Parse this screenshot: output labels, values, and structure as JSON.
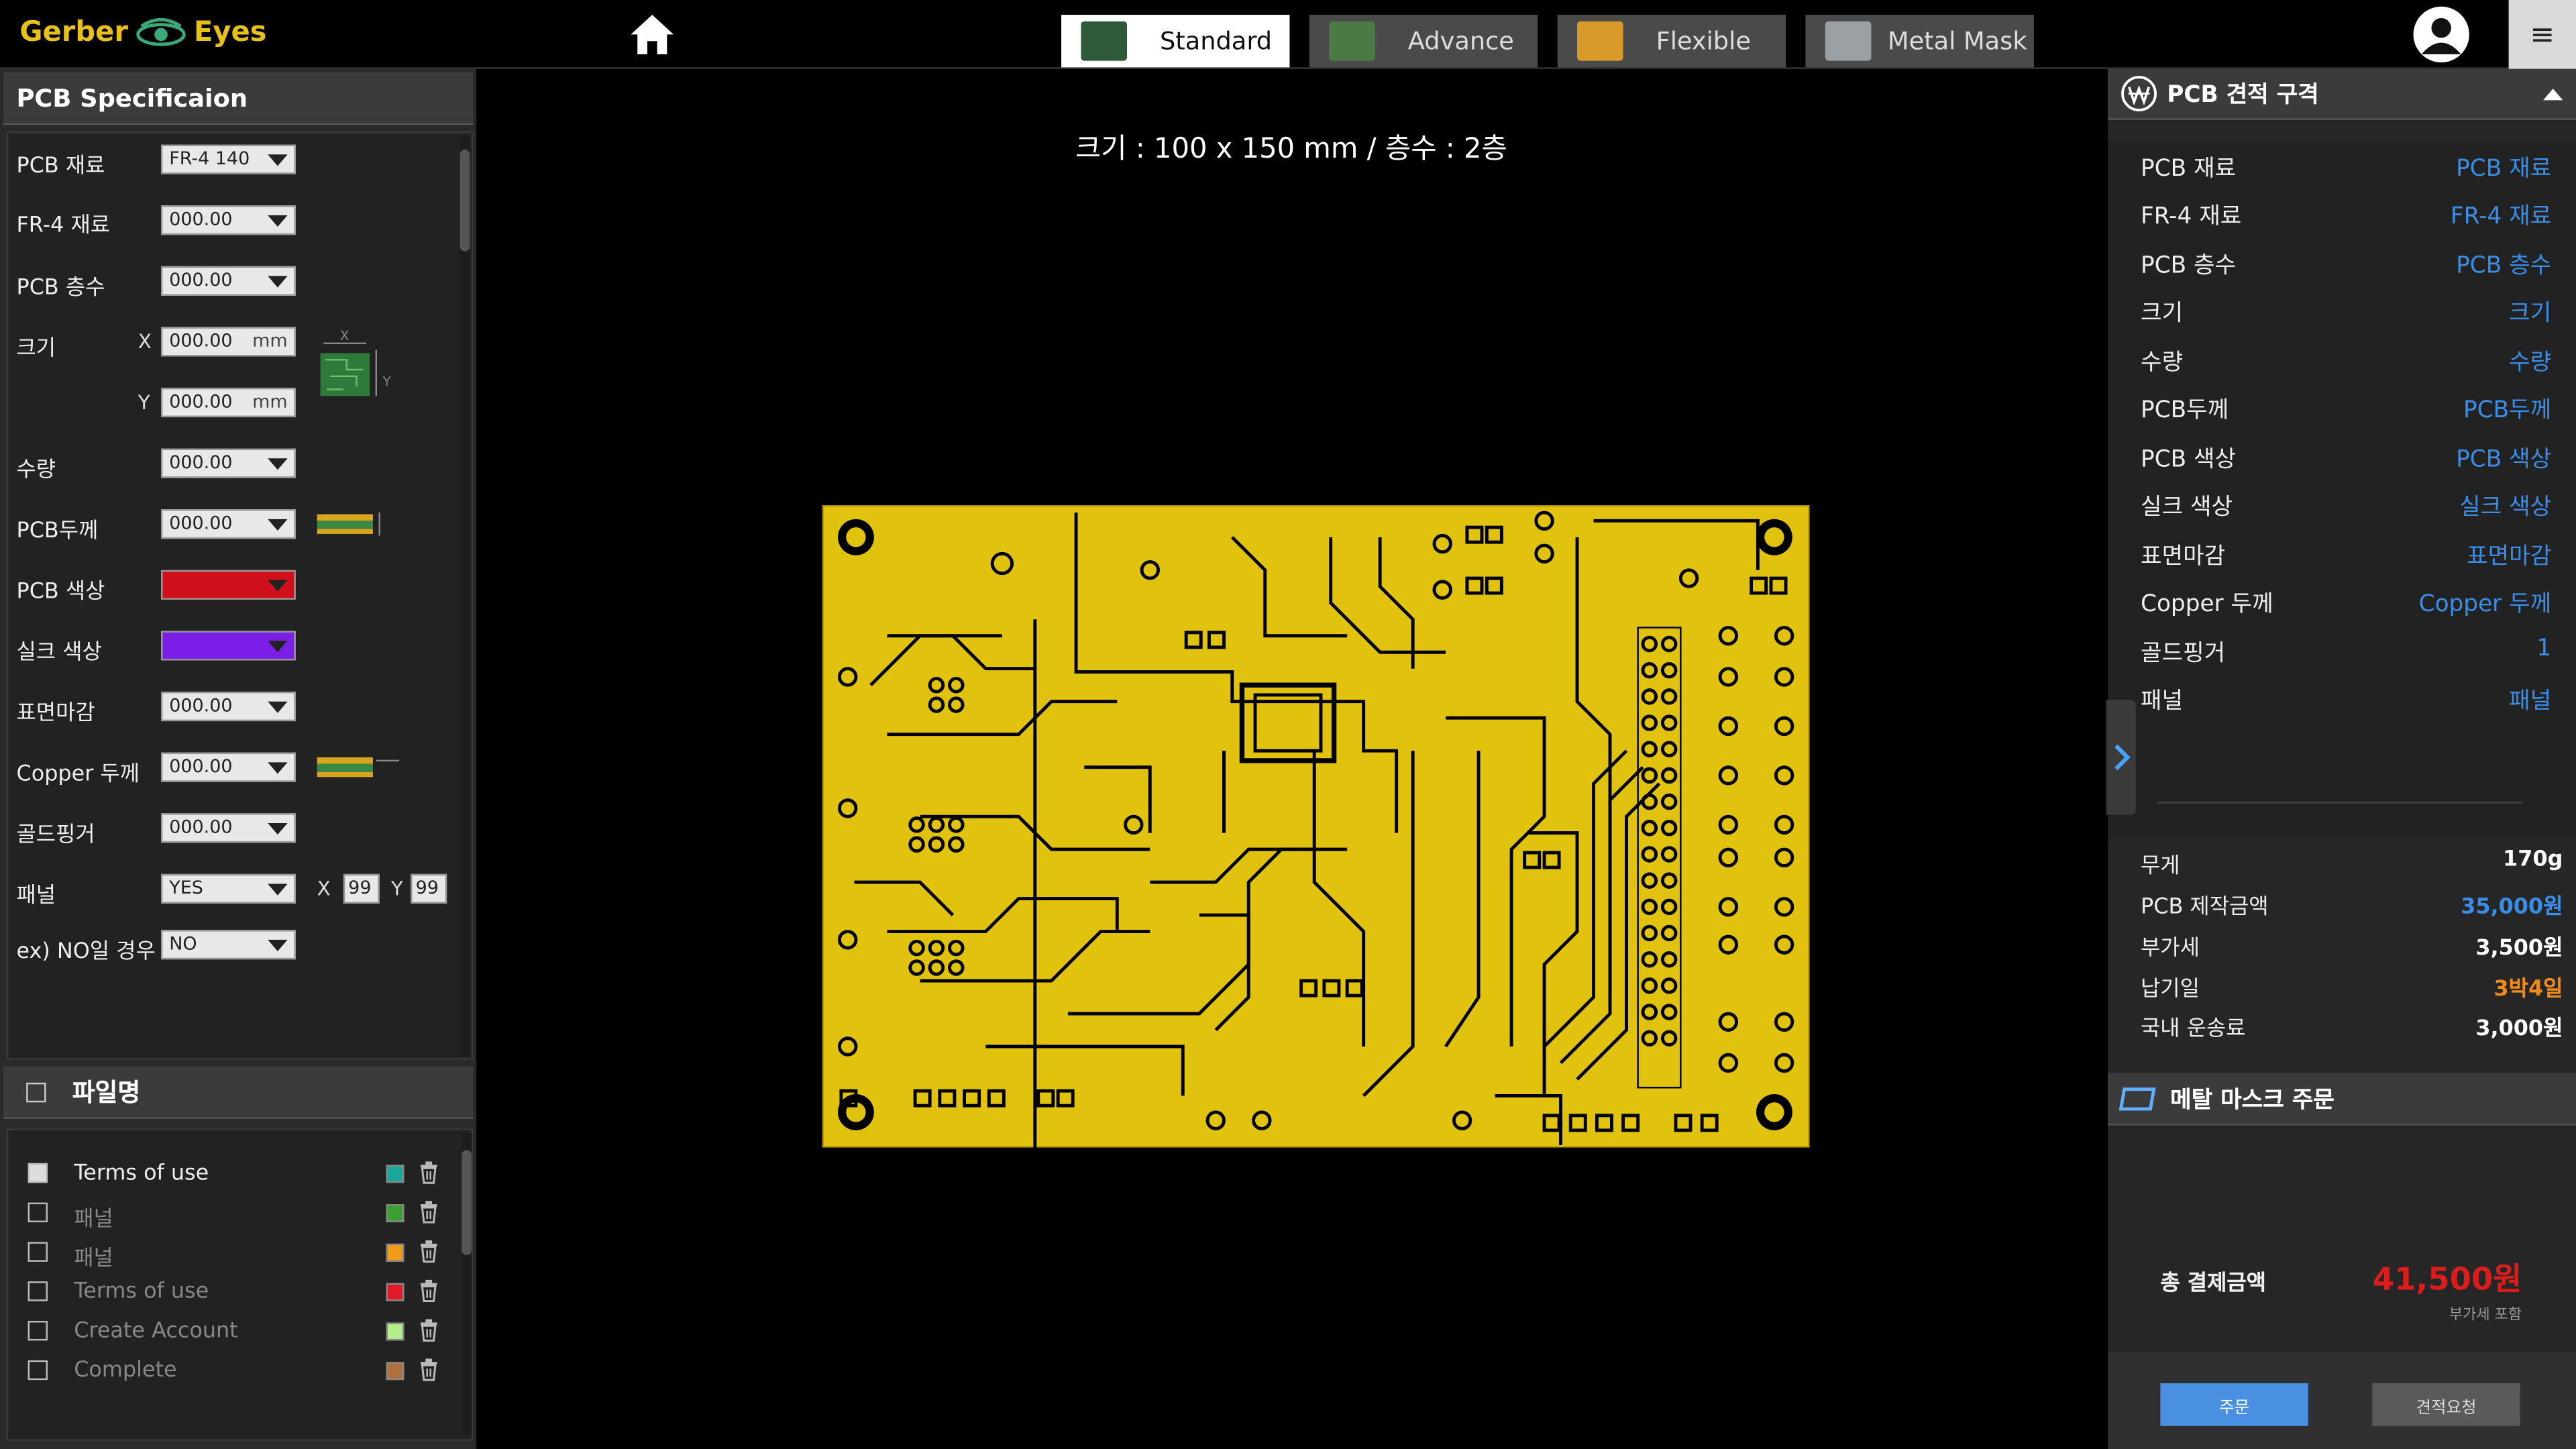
{
  "app": {
    "logo_left": "Gerber",
    "logo_right": "Eyes",
    "mode_tabs": [
      {
        "label": "Standard",
        "active": true
      },
      {
        "label": "Advance",
        "active": false
      },
      {
        "label": "Flexible",
        "active": false
      },
      {
        "label": "Metal Mask",
        "active": false
      }
    ],
    "menu_icon": "≡"
  },
  "left": {
    "spec_title": "PCB Specificaion",
    "fields": [
      {
        "label": "PCB  재료",
        "value": "FR-4 140"
      },
      {
        "label": "FR-4 재료",
        "value": "000.00"
      },
      {
        "label": "PCB 층수",
        "value": "000.00"
      },
      {
        "label": "크기",
        "x_label": "X",
        "x_value": "000.00",
        "y_label": "Y",
        "y_value": "000.00",
        "unit": "mm"
      },
      {
        "label": "수량",
        "value": "000.00"
      },
      {
        "label": "PCB두께",
        "value": "000.00"
      },
      {
        "label": "PCB 색상",
        "color": "#d0101a"
      },
      {
        "label": "실크 색상",
        "color": "#7b1fe8"
      },
      {
        "label": "표면마감",
        "value": "000.00"
      },
      {
        "label": "Copper 두께",
        "value": "000.00"
      },
      {
        "label": "골드핑거",
        "value": "000.00"
      },
      {
        "label": "패널",
        "value": "YES",
        "x_label": "X",
        "x_value": "99",
        "y_label": "Y",
        "y_value": "99"
      },
      {
        "label": "ex) NO일 경우",
        "value": "NO"
      }
    ],
    "size_diagram_x": "X",
    "size_diagram_y": "Y",
    "file_title": "파일명",
    "files": [
      {
        "name": "Terms of use",
        "checked": true,
        "color": "#1aa89a"
      },
      {
        "name": "패널",
        "checked": false,
        "color": "#3aa032"
      },
      {
        "name": "패널",
        "checked": false,
        "color": "#f29b1a"
      },
      {
        "name": "Terms of use",
        "checked": false,
        "color": "#e01a2a"
      },
      {
        "name": "Create Account",
        "checked": false,
        "color": "#b6ec8a"
      },
      {
        "name": "Complete",
        "checked": false,
        "color": "#b07040"
      }
    ]
  },
  "center": {
    "title": "크기 : 100 x 150 mm / 층수 : 2층"
  },
  "right": {
    "quote_title": "PCB 견적 구격",
    "rows": [
      {
        "k": "PCB  재료",
        "v": "PCB  재료"
      },
      {
        "k": "FR-4 재료",
        "v": "FR-4 재료"
      },
      {
        "k": "PCB 층수",
        "v": "PCB 층수"
      },
      {
        "k": "크기",
        "v": "크기"
      },
      {
        "k": "수량",
        "v": "수량"
      },
      {
        "k": "PCB두께",
        "v": "PCB두께"
      },
      {
        "k": "PCB 색상",
        "v": "PCB 색상"
      },
      {
        "k": "실크 색상",
        "v": "실크 색상"
      },
      {
        "k": "표면마감",
        "v": "표면마감"
      },
      {
        "k": "Copper 두께",
        "v": "Copper 두께"
      },
      {
        "k": "골드핑거",
        "v": "1"
      },
      {
        "k": "패널",
        "v": "패널"
      }
    ],
    "summary": [
      {
        "k": "무게",
        "v": "170g",
        "color": "#ffffff"
      },
      {
        "k": "PCB 제작금액",
        "v": "35,000원",
        "color": "#3a8ee8"
      },
      {
        "k": "부가세",
        "v": "3,500원",
        "color": "#ffffff"
      },
      {
        "k": "납기일",
        "v": "3박4일",
        "color": "#f08a1a"
      },
      {
        "k": "국내 운송료",
        "v": "3,000원",
        "color": "#ffffff"
      }
    ],
    "metal_title": "메탈 마스크 주문",
    "total_label": "총 결제금액",
    "total_value": "41,500원",
    "vat_note": "부가세 포함",
    "order_label": "주문",
    "quote_label": "견적요청"
  }
}
